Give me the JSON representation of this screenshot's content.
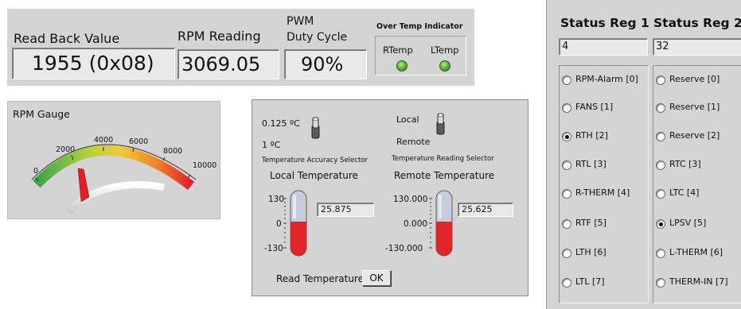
{
  "top": {
    "read_back_label": "Read Back Value",
    "read_back_value": "1955  (0x08)",
    "rpm_label": "RPM Reading",
    "rpm_value": "3069.05",
    "pwm_label_line1": "PWM",
    "pwm_label_line2": "Duty Cycle",
    "pwm_value": "90%",
    "overtemp_title": "Over Temp Indicator",
    "rtemp_label": "RTemp",
    "ltemp_label": "LTemp"
  },
  "gauge": {
    "title": "RPM Gauge",
    "ticks": [
      "0",
      "2000",
      "4000",
      "6000",
      "8000",
      "10000"
    ],
    "value_rpm": 3069.05
  },
  "temps": {
    "accuracy_hi": "0.125 ºC",
    "accuracy_lo": "1 ºC",
    "accuracy_caption": "Temperature Accuracy Selector",
    "local_title": "Local Temperature",
    "source_local": "Local",
    "source_remote": "Remote",
    "source_caption": "Temperature Reading Selector",
    "remote_title": "Remote Temperature",
    "local_scale": [
      "130",
      "0",
      "-130"
    ],
    "remote_scale": [
      "130.000",
      "0.000",
      "-130.000"
    ],
    "local_value": "25.875",
    "remote_value": "25.625",
    "read_label": "Read Temperature",
    "ok_label": "OK"
  },
  "status": {
    "reg1_title": "Status Reg 1",
    "reg1_value": "4",
    "reg2_title": "Status Reg 2",
    "reg2_value": "32",
    "reg1_items": [
      {
        "label": "RPM-Alarm [0]",
        "on": false
      },
      {
        "label": "FANS [1]",
        "on": false
      },
      {
        "label": "RTH [2]",
        "on": true
      },
      {
        "label": "RTL [3]",
        "on": false
      },
      {
        "label": "R-THERM [4]",
        "on": false
      },
      {
        "label": "RTF [5]",
        "on": false
      },
      {
        "label": "LTH [6]",
        "on": false
      },
      {
        "label": "LTL [7]",
        "on": false
      }
    ],
    "reg2_items": [
      {
        "label": "Reserve [0]",
        "on": false
      },
      {
        "label": "Reserve [1]",
        "on": false
      },
      {
        "label": "Reserve [2]",
        "on": false
      },
      {
        "label": "RTC [3]",
        "on": false
      },
      {
        "label": "LTC [4]",
        "on": false
      },
      {
        "label": "LPSV [5]",
        "on": true
      },
      {
        "label": "L-THERM [6]",
        "on": false
      },
      {
        "label": "THERM-IN [7]",
        "on": false
      }
    ]
  }
}
